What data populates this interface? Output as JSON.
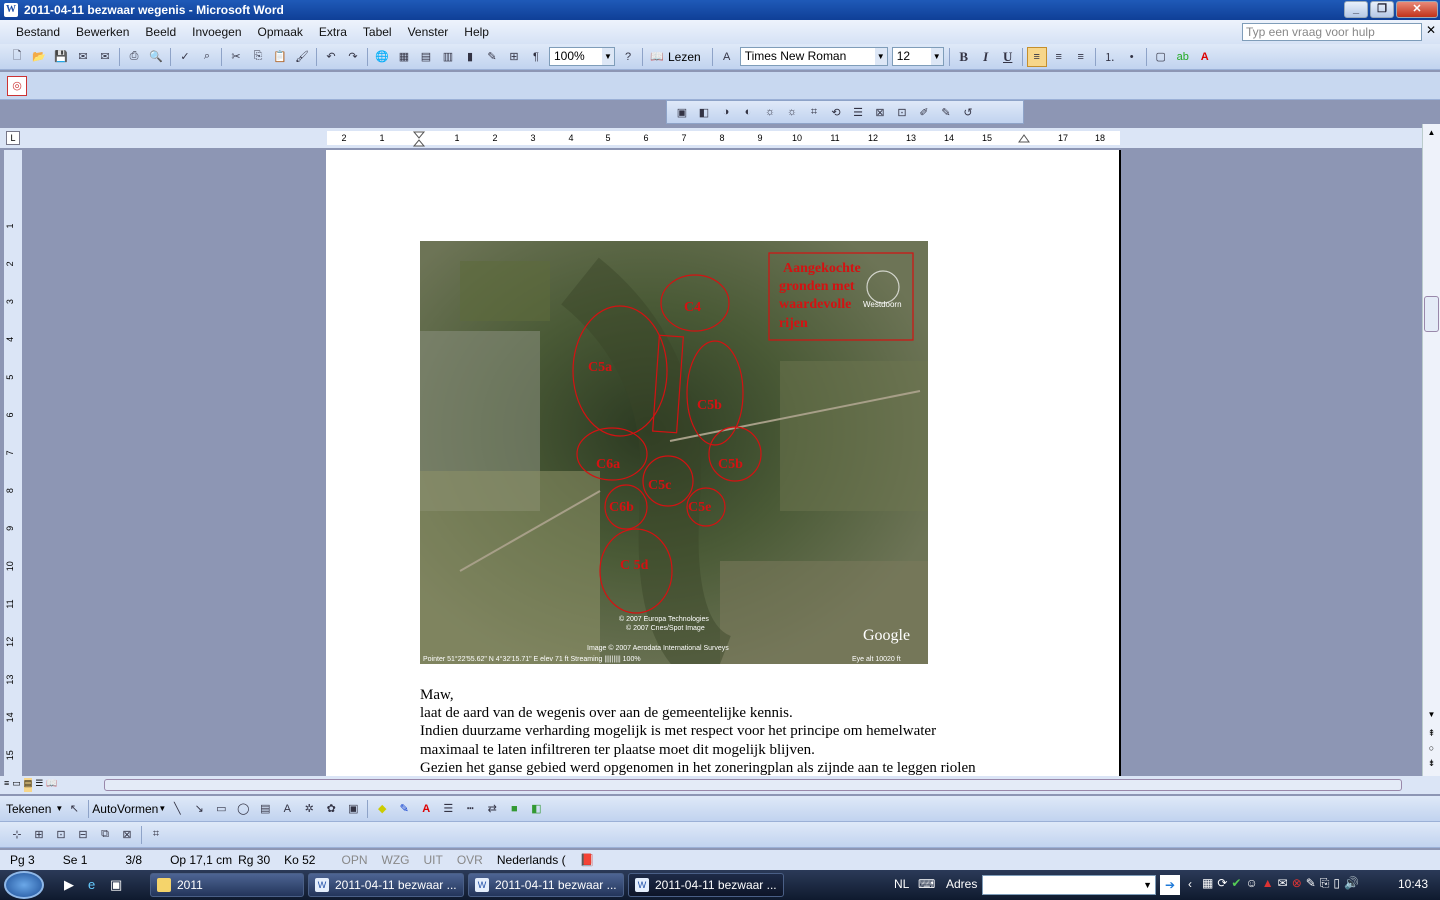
{
  "window": {
    "title": "2011-04-11 bezwaar wegenis - Microsoft Word",
    "word_icon": "W"
  },
  "menu": [
    "Bestand",
    "Bewerken",
    "Beeld",
    "Invoegen",
    "Opmaak",
    "Extra",
    "Tabel",
    "Venster",
    "Help"
  ],
  "help_placeholder": "Typ een vraag voor hulp",
  "standard_toolbar": {
    "zoom": "100%",
    "read_label": "Lezen"
  },
  "format_toolbar": {
    "font": "Times New Roman",
    "size": "12",
    "bold": "B",
    "italic": "I",
    "underline": "U"
  },
  "ruler_numbers": [
    "2",
    "1",
    "1",
    "2",
    "3",
    "4",
    "5",
    "6",
    "7",
    "8",
    "9",
    "10",
    "11",
    "12",
    "13",
    "14",
    "15",
    "17",
    "18"
  ],
  "vruler_numbers": [
    "1",
    "2",
    "3",
    "4",
    "5",
    "6",
    "7",
    "8",
    "9",
    "10",
    "11",
    "12",
    "13",
    "14",
    "15"
  ],
  "map": {
    "legend": [
      "Aangekochte",
      "gronden met",
      "waardevolle",
      "rijen"
    ],
    "labels": [
      "C4",
      "C5a",
      "C5b",
      "C6a",
      "C5b",
      "C5c",
      "C6b",
      "C5e",
      "C 5d"
    ],
    "place": "Westdoorn",
    "copyright": [
      "© 2007 Europa Technologies",
      "© 2007 Cnes/Spot Image",
      "Image © 2007 Aerodata International Surveys"
    ],
    "brand": "Google",
    "pointer": "Pointer  51°22'55.62\" N     4°32'15.71\" E      elev    71 ft Streaming ||||||||| 100%",
    "eye_alt": "Eye alt      10020 ft"
  },
  "body_lines": [
    "Maw,",
    "laat de aard van de wegenis over aan de gemeentelijke kennis.",
    "Indien duurzame verharding mogelijk is met respect voor het principe om hemelwater",
    "maximaal te laten infiltreren ter plaatse moet dit mogelijk blijven.",
    "Gezien het ganse gebied werd opgenomen in het zoneringplan als zijnde aan te leggen riolen"
  ],
  "drawing_toolbar": {
    "draw": "Tekenen",
    "autoshapes": "AutoVormen"
  },
  "status": {
    "page": "Pg 3",
    "section": "Se 1",
    "of": "3/8",
    "at": "Op 17,1 cm",
    "line": "Rg 30",
    "col": "Ko 52",
    "modes": [
      "OPN",
      "WZG",
      "UIT",
      "OVR"
    ],
    "lang": "Nederlands ("
  },
  "taskbar": {
    "items": [
      "2011",
      "2011-04-11 bezwaar ...",
      "2011-04-11 bezwaar ...",
      "2011-04-11 bezwaar ..."
    ],
    "lang": "NL",
    "address_label": "Adres",
    "clock": "10:43"
  }
}
